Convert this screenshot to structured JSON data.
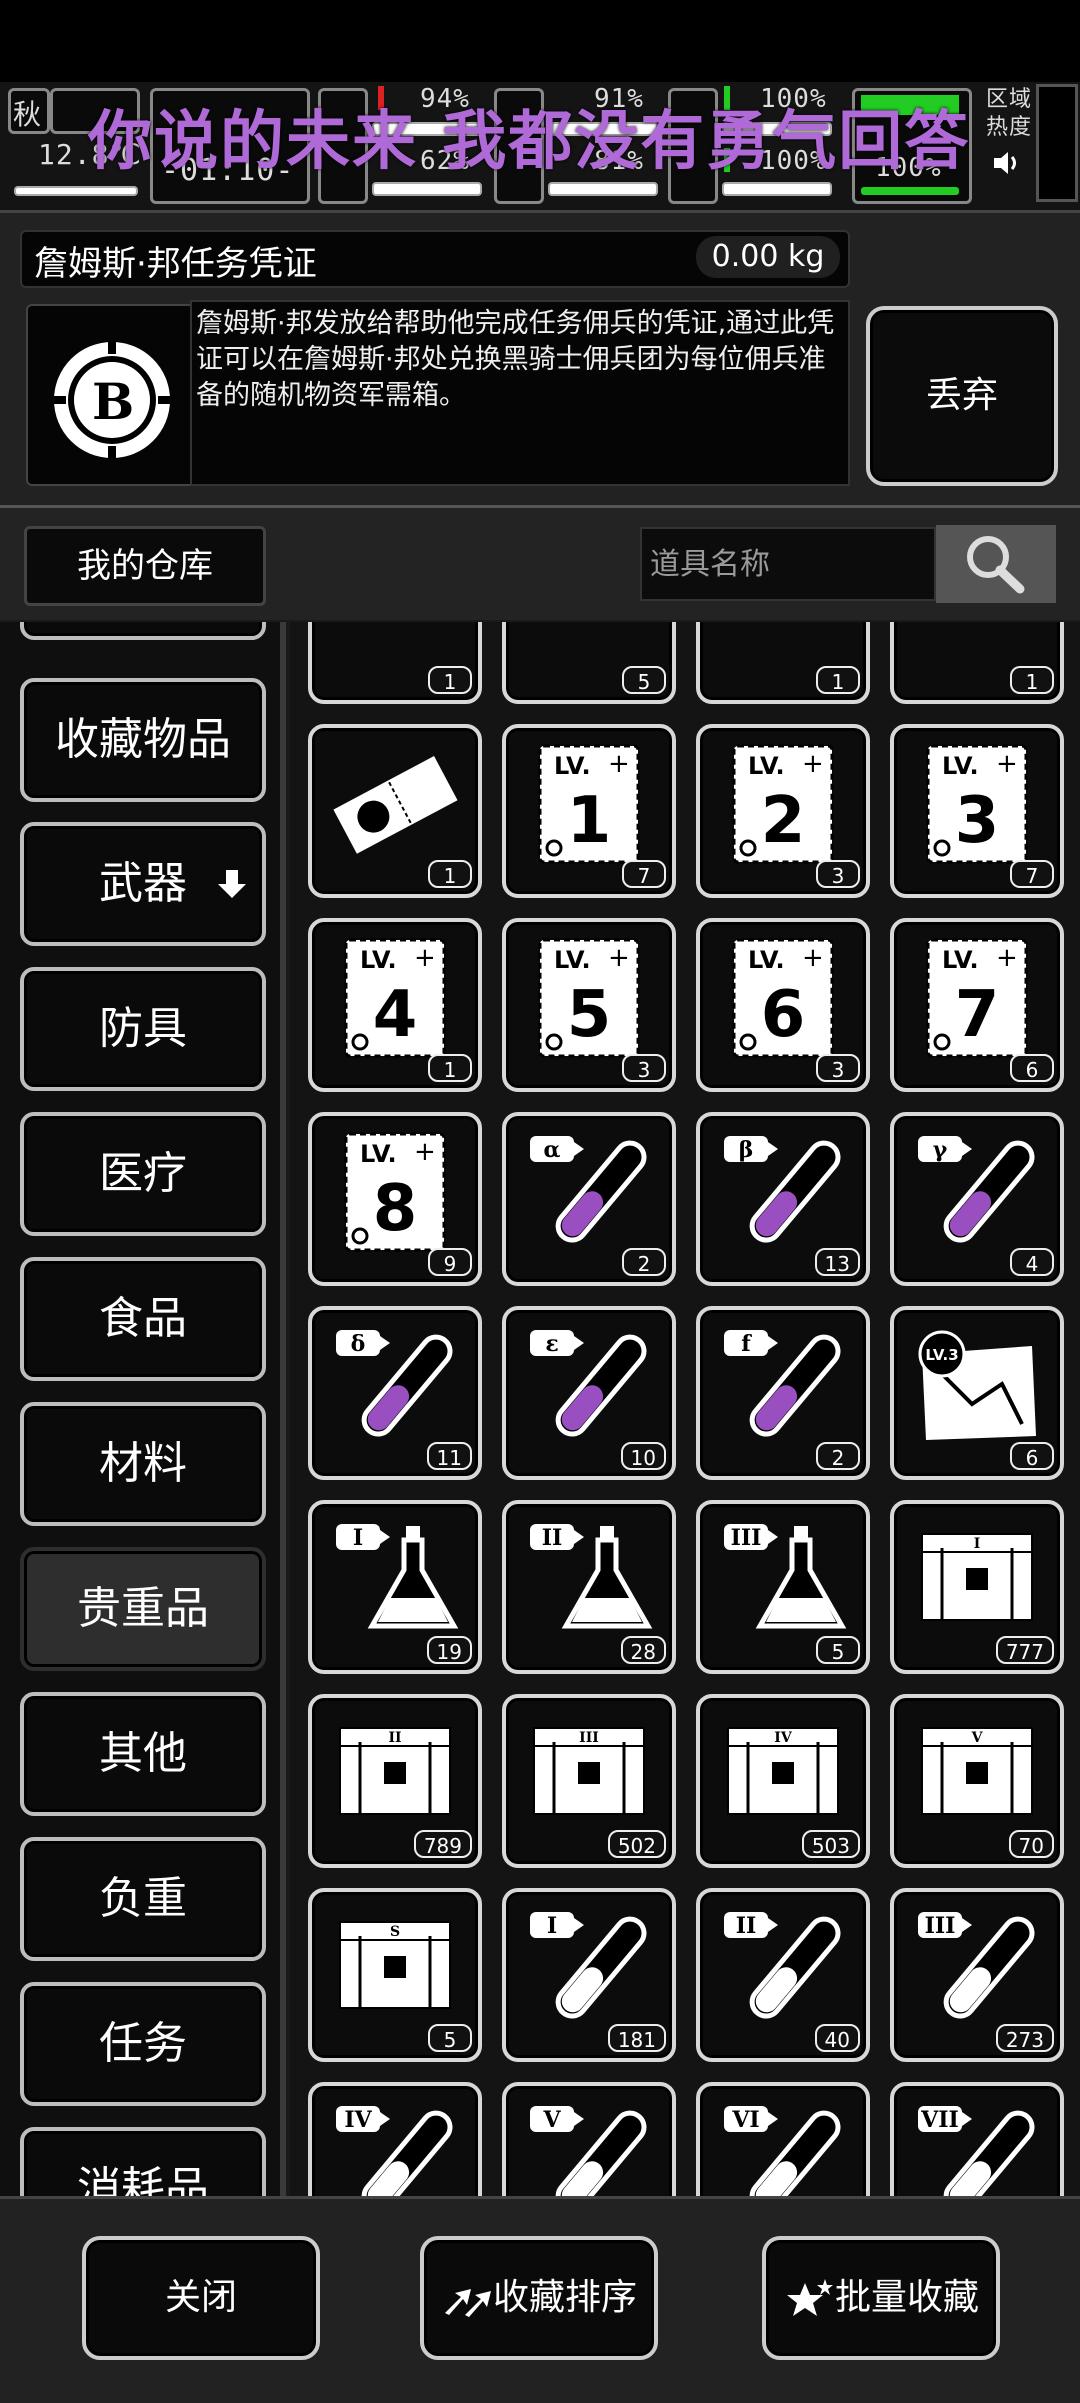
{
  "status": {
    "season": "秋",
    "temperature": "12.8℃",
    "clock": "-01:10-",
    "stat_a_top": "94%",
    "stat_a_bottom": "62%",
    "stat_b_top": "91%",
    "stat_b_bottom": "81%",
    "stat_c_top": "100%",
    "stat_c_bottom": "100%",
    "stat_d_bottom": "100%",
    "zone_label": "区域\n热度",
    "accent_green": "#22cc22",
    "accent_red": "#dd2222"
  },
  "overlay": {
    "lyric": "你说的未来 我都没有勇气回答"
  },
  "item": {
    "name": "詹姆斯·邦任务凭证",
    "weight": "0.00 kg",
    "description": "詹姆斯·邦发放给帮助他完成任务佣兵的凭证,通过此凭证可以在詹姆斯·邦处兑换黑骑士佣兵团为每位佣兵准备的随机物资军需箱。",
    "icon_letter": "B",
    "discard_label": "丢弃"
  },
  "warehouse": {
    "title": "我的仓库",
    "search_placeholder": "道具名称"
  },
  "categories": [
    {
      "label": "收藏物品"
    },
    {
      "label": "武器"
    },
    {
      "label": "防具"
    },
    {
      "label": "医疗"
    },
    {
      "label": "食品"
    },
    {
      "label": "材料"
    },
    {
      "label": "贵重品",
      "active": true
    },
    {
      "label": "其他"
    },
    {
      "label": "负重"
    },
    {
      "label": "任务"
    },
    {
      "label": "消耗品"
    }
  ],
  "items": [
    {
      "icon": "voucher-icon",
      "count": "1"
    },
    {
      "icon": "voucher-icon",
      "count": "5"
    },
    {
      "icon": "voucher-icon",
      "count": "1"
    },
    {
      "icon": "voucher-icon",
      "count": "1"
    },
    {
      "icon": "ticket-icon",
      "count": "1"
    },
    {
      "icon": "level-card-icon",
      "level": "1",
      "count": "7"
    },
    {
      "icon": "level-card-icon",
      "level": "2",
      "count": "3"
    },
    {
      "icon": "level-card-icon",
      "level": "3",
      "count": "7"
    },
    {
      "icon": "level-card-icon",
      "level": "4",
      "count": "1"
    },
    {
      "icon": "level-card-icon",
      "level": "5",
      "count": "3"
    },
    {
      "icon": "level-card-icon",
      "level": "6",
      "count": "3"
    },
    {
      "icon": "level-card-icon",
      "level": "7",
      "count": "6"
    },
    {
      "icon": "level-card-icon",
      "level": "8",
      "count": "9"
    },
    {
      "icon": "purple-tube-icon",
      "tag": "α",
      "count": "2"
    },
    {
      "icon": "purple-tube-icon",
      "tag": "β",
      "count": "13"
    },
    {
      "icon": "purple-tube-icon",
      "tag": "γ",
      "count": "4"
    },
    {
      "icon": "purple-tube-icon",
      "tag": "δ",
      "count": "11"
    },
    {
      "icon": "purple-tube-icon",
      "tag": "ε",
      "count": "10"
    },
    {
      "icon": "purple-tube-icon",
      "tag": "f",
      "count": "2"
    },
    {
      "icon": "map-icon",
      "tag": "LV.3",
      "count": "6"
    },
    {
      "icon": "flask-icon",
      "tag": "I",
      "count": "19"
    },
    {
      "icon": "flask-icon",
      "tag": "II",
      "count": "28"
    },
    {
      "icon": "flask-icon",
      "tag": "III",
      "count": "5"
    },
    {
      "icon": "crate-icon",
      "tag": "I",
      "count": "777"
    },
    {
      "icon": "crate-icon",
      "tag": "II",
      "count": "789"
    },
    {
      "icon": "crate-icon",
      "tag": "III",
      "count": "502"
    },
    {
      "icon": "crate-icon",
      "tag": "IV",
      "count": "503"
    },
    {
      "icon": "crate-icon",
      "tag": "V",
      "count": "70"
    },
    {
      "icon": "crate-icon",
      "tag": "S",
      "count": "5"
    },
    {
      "icon": "white-tube-icon",
      "tag": "I",
      "count": "181"
    },
    {
      "icon": "white-tube-icon",
      "tag": "II",
      "count": "40"
    },
    {
      "icon": "white-tube-icon",
      "tag": "III",
      "count": "273"
    },
    {
      "icon": "white-tube-icon",
      "tag": "IV",
      "count": ""
    },
    {
      "icon": "white-tube-icon",
      "tag": "V",
      "count": ""
    },
    {
      "icon": "white-tube-icon",
      "tag": "VI",
      "count": ""
    },
    {
      "icon": "white-tube-icon",
      "tag": "VII",
      "count": ""
    }
  ],
  "bottom": {
    "close": "关闭",
    "sort": "收藏排序",
    "batch": "批量收藏"
  }
}
